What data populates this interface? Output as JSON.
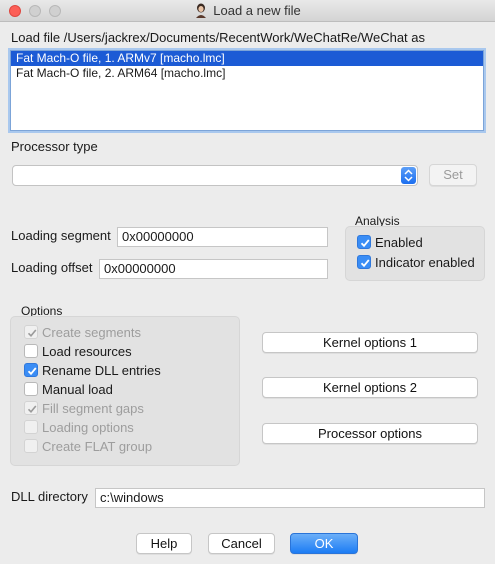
{
  "window": {
    "title": "Load a new file"
  },
  "load_file_label": "Load file /Users/jackrex/Documents/RecentWork/WeChatRe/WeChat as",
  "file_types": [
    {
      "label": "Fat Mach-O file, 1. ARMv7 [macho.lmc]",
      "selected": true
    },
    {
      "label": "Fat Mach-O file, 2. ARM64 [macho.lmc]",
      "selected": false
    }
  ],
  "processor": {
    "label": "Processor type",
    "value": "",
    "set_label": "Set"
  },
  "analysis": {
    "title": "Analysis",
    "enabled": {
      "label": "Enabled",
      "checked": true
    },
    "indicator": {
      "label": "Indicator enabled",
      "checked": true
    }
  },
  "loading": {
    "segment_label": "Loading segment",
    "segment_value": "0x00000000",
    "offset_label": "Loading offset",
    "offset_value": "0x00000000"
  },
  "options": {
    "title": "Options",
    "items": [
      {
        "label": "Create segments",
        "checked": true,
        "enabled": false
      },
      {
        "label": "Load resources",
        "checked": false,
        "enabled": true
      },
      {
        "label": "Rename DLL entries",
        "checked": true,
        "enabled": true
      },
      {
        "label": "Manual load",
        "checked": false,
        "enabled": true
      },
      {
        "label": "Fill segment gaps",
        "checked": true,
        "enabled": false
      },
      {
        "label": "Loading options",
        "checked": false,
        "enabled": false
      },
      {
        "label": "Create FLAT group",
        "checked": false,
        "enabled": false
      }
    ]
  },
  "side_buttons": {
    "kernel1": "Kernel options 1",
    "kernel2": "Kernel options 2",
    "processor": "Processor options"
  },
  "dll": {
    "label": "DLL directory",
    "value": "c:\\windows"
  },
  "footer": {
    "help": "Help",
    "cancel": "Cancel",
    "ok": "OK"
  },
  "colors": {
    "accent": "#1c7cf4",
    "selection": "#1c5bd5",
    "close": "#fc5f57"
  }
}
